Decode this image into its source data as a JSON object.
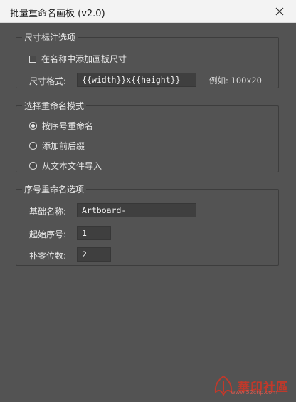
{
  "window": {
    "title": "批量重命名画板 (v2.0)",
    "close_icon": "close-icon"
  },
  "size_options": {
    "legend": "尺寸标注选项",
    "add_size_label": "在名称中添加画板尺寸",
    "add_size_checked": false,
    "format_label": "尺寸格式:",
    "format_value": "{{width}}x{{height}}",
    "example": "例如: 100x20"
  },
  "mode": {
    "legend": "选择重命名模式",
    "options": [
      {
        "label": "按序号重命名",
        "selected": true
      },
      {
        "label": "添加前后缀",
        "selected": false
      },
      {
        "label": "从文本文件导入",
        "selected": false
      }
    ]
  },
  "sequence_options": {
    "legend": "序号重命名选项",
    "base_name_label": "基础名称:",
    "base_name_value": "Artboard-",
    "start_label": "起始序号:",
    "start_value": "1",
    "padding_label": "补零位数:",
    "padding_value": "2"
  },
  "watermark": {
    "text": "華印社區",
    "url": "www.52cnp.com"
  }
}
